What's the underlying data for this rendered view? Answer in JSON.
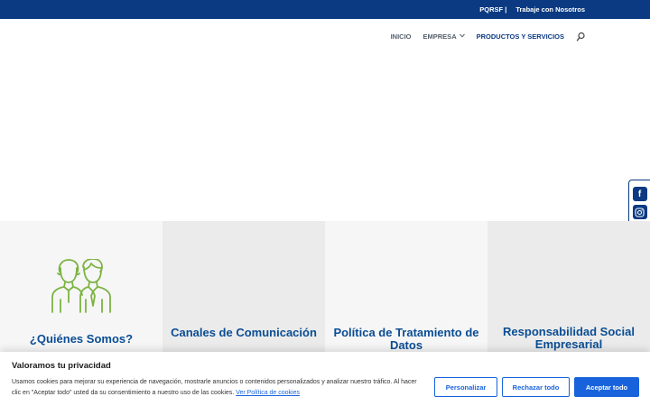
{
  "topbar": {
    "links": [
      "PQRSF |",
      "Trabaje con Nosotros"
    ]
  },
  "nav": {
    "items": [
      {
        "label": "INICIO"
      },
      {
        "label": "EMPRESA"
      },
      {
        "label": "PRODUCTOS Y SERVICIOS"
      }
    ]
  },
  "social": {
    "facebook": "f"
  },
  "cards": [
    {
      "title": "¿Quiénes Somos?"
    },
    {
      "title": "Canales de Comunicación"
    },
    {
      "title": "Política de Tratamiento de Datos"
    },
    {
      "title": "Responsabilidad Social Empresarial"
    }
  ],
  "cookie": {
    "title": "Valoramos tu privacidad",
    "text": "Usamos cookies para mejorar su experiencia de navegación, mostrarle anuncios o contenidos personalizados y analizar nuestro tráfico. Al hacer clic en \"Aceptar todo\" usted da su consentimiento a nuestro uso de las cookies.",
    "link": "Ver Política de cookies",
    "buttons": {
      "customize": "Personalizar",
      "reject": "Rechazar todo",
      "accept": "Aceptar todo"
    }
  },
  "colors": {
    "brand": "#0b3a82",
    "title": "#0b4d94",
    "icon_green": "#7cb342",
    "cookie_blue": "#1863dc"
  }
}
